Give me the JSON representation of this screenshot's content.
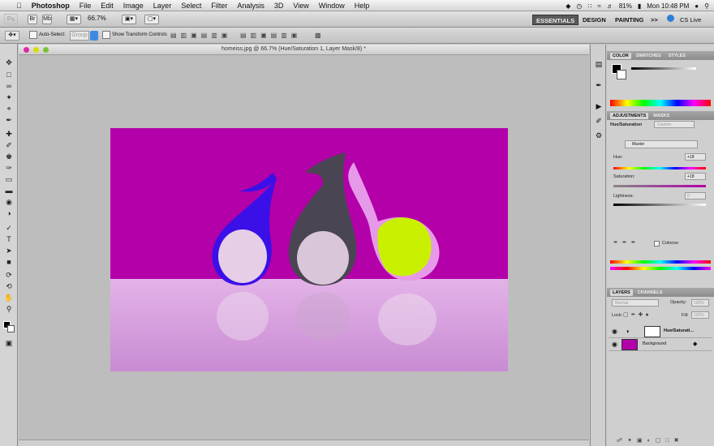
{
  "menubar": {
    "app": "Photoshop",
    "items": [
      "File",
      "Edit",
      "Image",
      "Layer",
      "Select",
      "Filter",
      "Analysis",
      "3D",
      "View",
      "Window",
      "Help"
    ],
    "battery": "81%",
    "clock": "Mon 10:48 PM"
  },
  "appbar": {
    "badge": "Ps",
    "zoom": "66.7%",
    "workspaces": [
      "ESSENTIALS",
      "DESIGN",
      "PAINTING"
    ],
    "more": ">>",
    "cs_live": "CS Live"
  },
  "options": {
    "auto_select_label": "Auto-Select:",
    "auto_select_value": "Group",
    "show_transform_label": "Show Transform Controls"
  },
  "document": {
    "title": "homeiss.jpg @ 66.7% (Hue/Saturation 1, Layer Mask/8) *"
  },
  "panels": {
    "color": {
      "tabs": [
        "COLOR",
        "SWATCHES",
        "STYLES"
      ]
    },
    "adjustments": {
      "tabs": [
        "ADJUSTMENTS",
        "MASKS"
      ],
      "title": "Hue/Saturation",
      "preset": "Custom",
      "channel": "Master",
      "hue_label": "Hue:",
      "hue_value": "+18",
      "saturation_label": "Saturation:",
      "saturation_value": "+18",
      "lightness_label": "Lightness:",
      "lightness_value": "0",
      "colorize_label": "Colorize"
    },
    "layers": {
      "tabs": [
        "LAYERS",
        "CHANNELS"
      ],
      "blend_mode": "Normal",
      "opacity_label": "Opacity:",
      "opacity_value": "100%",
      "lock_label": "Lock:",
      "fill_label": "Fill:",
      "fill_value": "100%",
      "rows": [
        {
          "name": "Hue/Saturati..."
        },
        {
          "name": "Background"
        }
      ]
    }
  },
  "colors": {
    "canvas_bg": "#b300a9",
    "canvas_floor": "#d7a0e0",
    "drop_blue": "#3b10e8",
    "drop_gray": "#4a4552",
    "drop_lime": "#c9f000"
  }
}
